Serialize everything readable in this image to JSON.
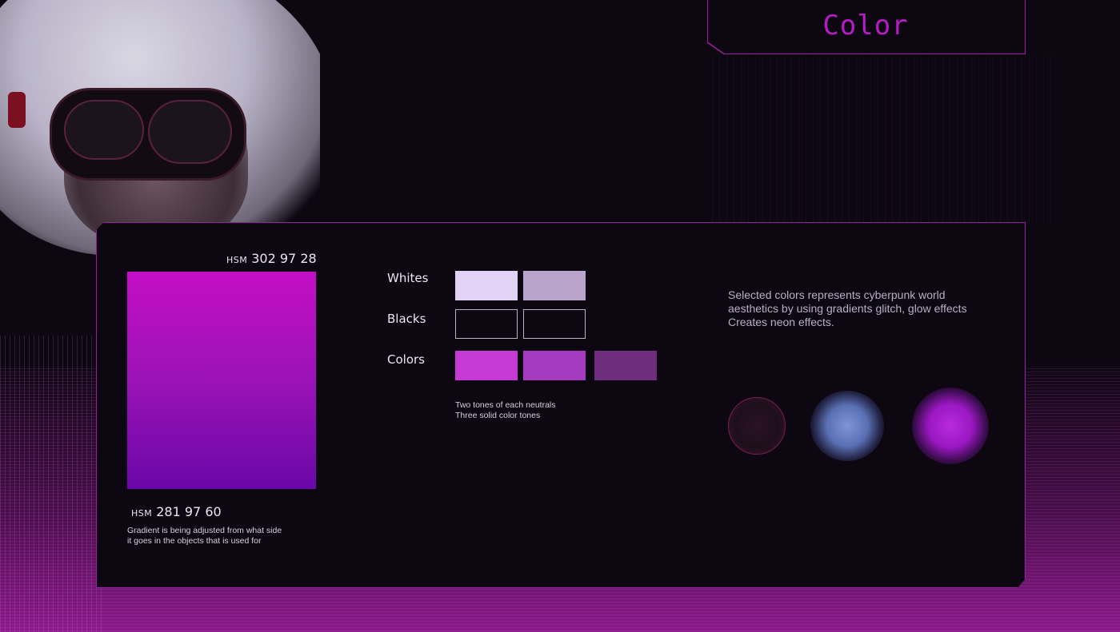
{
  "header": {
    "title": "Color"
  },
  "gradient": {
    "top_tag": "HSM",
    "top_value": "302 97 28",
    "bottom_tag": "HSM",
    "bottom_value": "281 97 60",
    "note": "Gradient is being adjusted from what side it goes in the objects that is used for",
    "colors": [
      "#c40ec5",
      "#6a07a8"
    ]
  },
  "palette": {
    "whites_label": "Whites",
    "blacks_label": "Blacks",
    "colors_label": "Colors",
    "whites": [
      "#e2d3f6",
      "#b8a4cc"
    ],
    "blacks": [
      "#0d0711",
      "#0d0711"
    ],
    "colors": [
      "#c43ad2",
      "#a53bbe",
      "#6f2d7d"
    ],
    "note_line_1": "Two tones of each neutrals",
    "note_line_2": "Three solid color tones"
  },
  "description": "Selected colors represents cyberpunk world aesthetics by using gradients glitch, glow effects Creates neon effects.",
  "effects": {
    "orbs": [
      "dark-circle",
      "blue-glow",
      "purple-glow"
    ]
  },
  "accent_color": "#a01aa6"
}
